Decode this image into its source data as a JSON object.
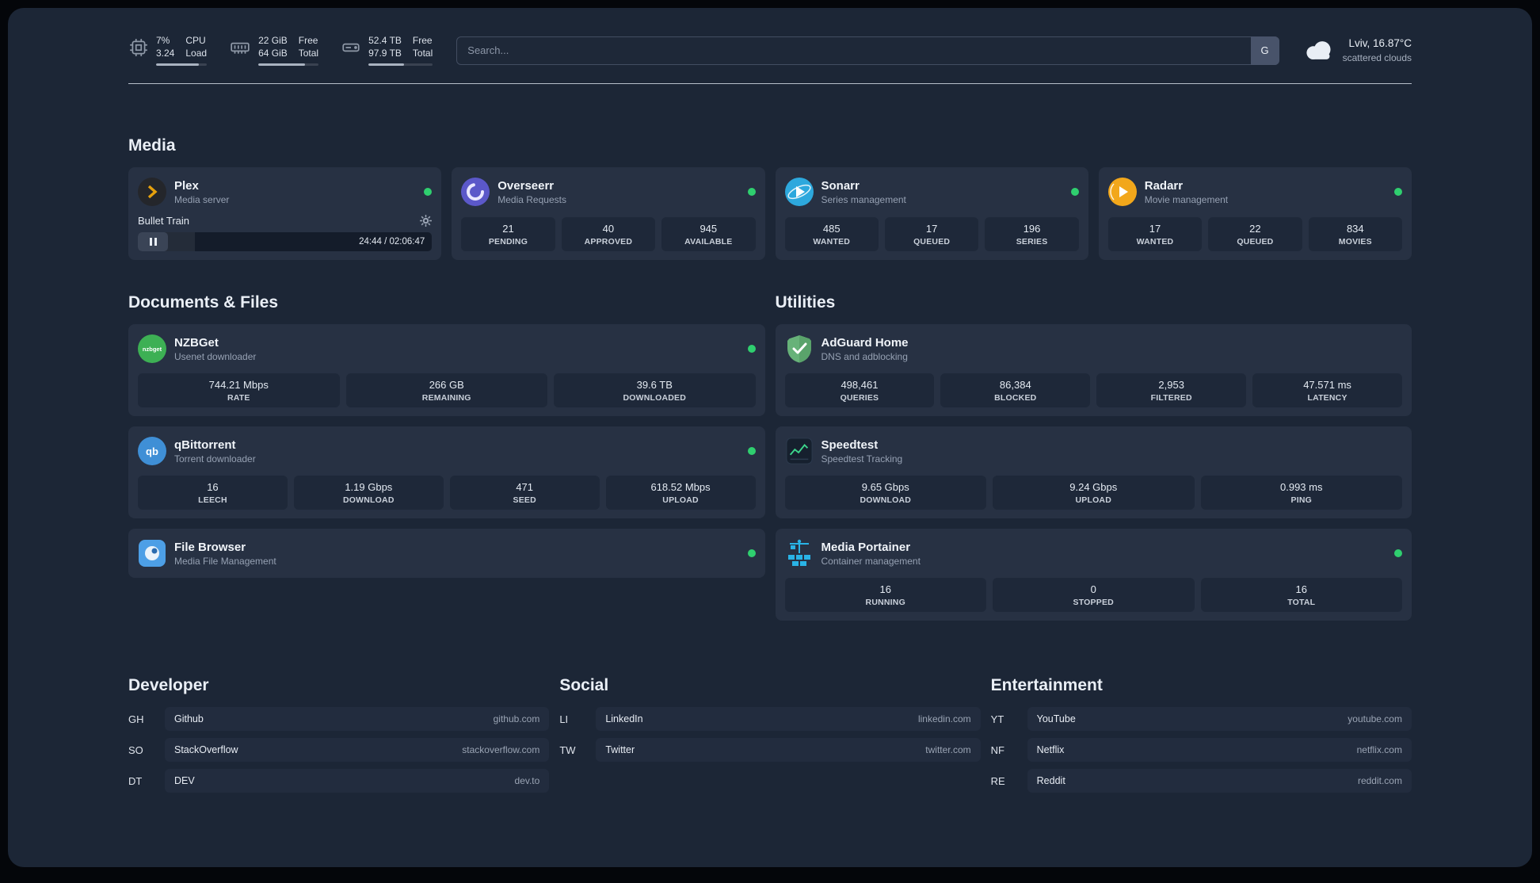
{
  "colors": {
    "page_background": "#1c2636",
    "card_background": "#273143",
    "tile_background": "#1e2839",
    "status_online": "#2fcf6f",
    "plex_accent": "#e5a00d",
    "overseerr_accent": "#5b58c9",
    "sonarr_accent": "#2da8dd",
    "radarr_accent": "#f2a71b",
    "nzbget_accent": "#3db054",
    "qbittorrent_accent": "#3f8fd6",
    "filebrowser_accent": "#4d9fe6",
    "adguard_accent": "#67b279",
    "speedtest_accent": "#3dd68c",
    "portainer_accent": "#29b3e6"
  },
  "icons": {
    "cpu": "chip-outline",
    "memory": "ram-stick-outline",
    "disk": "hard-drive-outline",
    "weather": "cloud-filled",
    "plex": "amber-chevron-in-dark-circle",
    "overseerr": "purple-swirl-circle",
    "sonarr": "blue-circle-play-orbit",
    "radarr": "amber-circle-play-orbit",
    "nzbget": "green-circle-wordmark",
    "qbittorrent": "blue-circle-qb",
    "filebrowser": "blue-rounded-square-disc",
    "adguard": "green-shield-check",
    "speedtest": "dark-square-green-graph",
    "portainer": "blue-crane-containers",
    "gear": "settings-gear",
    "pause": "pause-bars"
  },
  "topbar": {
    "cpu": {
      "value_top": "7%",
      "value_bottom": "3.24",
      "label_top": "CPU",
      "label_bottom": "Load",
      "meter_percent": 85
    },
    "memory": {
      "value_top": "22 GiB",
      "value_bottom": "64 GiB",
      "label_top": "Free",
      "label_bottom": "Total",
      "meter_percent": 78
    },
    "disk": {
      "value_top": "52.4 TB",
      "value_bottom": "97.9 TB",
      "label_top": "Free",
      "label_bottom": "Total",
      "meter_percent": 55
    },
    "search": {
      "placeholder": "Search...",
      "provider_label": "G"
    },
    "weather": {
      "location": "Lviv, 16.87°C",
      "condition": "scattered clouds"
    }
  },
  "media": {
    "heading": "Media",
    "plex": {
      "name": "Plex",
      "desc": "Media server",
      "status": "online",
      "player": {
        "title": "Bullet Train",
        "time": "24:44 / 02:06:47",
        "progress_percent": 19.5
      }
    },
    "overseerr": {
      "name": "Overseerr",
      "desc": "Media Requests",
      "status": "online",
      "stats": [
        {
          "value": "21",
          "label": "PENDING"
        },
        {
          "value": "40",
          "label": "APPROVED"
        },
        {
          "value": "945",
          "label": "AVAILABLE"
        }
      ]
    },
    "sonarr": {
      "name": "Sonarr",
      "desc": "Series management",
      "status": "online",
      "stats": [
        {
          "value": "485",
          "label": "WANTED"
        },
        {
          "value": "17",
          "label": "QUEUED"
        },
        {
          "value": "196",
          "label": "SERIES"
        }
      ]
    },
    "radarr": {
      "name": "Radarr",
      "desc": "Movie management",
      "status": "online",
      "stats": [
        {
          "value": "17",
          "label": "WANTED"
        },
        {
          "value": "22",
          "label": "QUEUED"
        },
        {
          "value": "834",
          "label": "MOVIES"
        }
      ]
    }
  },
  "documents": {
    "heading": "Documents & Files",
    "nzbget": {
      "name": "NZBGet",
      "desc": "Usenet downloader",
      "status": "online",
      "icon_text": "nzbget",
      "stats": [
        {
          "value": "744.21 Mbps",
          "label": "RATE"
        },
        {
          "value": "266 GB",
          "label": "REMAINING"
        },
        {
          "value": "39.6 TB",
          "label": "DOWNLOADED"
        }
      ]
    },
    "qbittorrent": {
      "name": "qBittorrent",
      "desc": "Torrent downloader",
      "status": "online",
      "icon_text": "qb",
      "stats": [
        {
          "value": "16",
          "label": "LEECH"
        },
        {
          "value": "1.19 Gbps",
          "label": "DOWNLOAD"
        },
        {
          "value": "471",
          "label": "SEED"
        },
        {
          "value": "618.52 Mbps",
          "label": "UPLOAD"
        }
      ]
    },
    "filebrowser": {
      "name": "File Browser",
      "desc": "Media File Management",
      "status": "online"
    }
  },
  "utilities": {
    "heading": "Utilities",
    "adguard": {
      "name": "AdGuard Home",
      "desc": "DNS and adblocking",
      "stats": [
        {
          "value": "498,461",
          "label": "QUERIES"
        },
        {
          "value": "86,384",
          "label": "BLOCKED"
        },
        {
          "value": "2,953",
          "label": "FILTERED"
        },
        {
          "value": "47.571 ms",
          "label": "LATENCY"
        }
      ]
    },
    "speedtest": {
      "name": "Speedtest",
      "desc": "Speedtest Tracking",
      "stats": [
        {
          "value": "9.65 Gbps",
          "label": "DOWNLOAD"
        },
        {
          "value": "9.24 Gbps",
          "label": "UPLOAD"
        },
        {
          "value": "0.993 ms",
          "label": "PING"
        }
      ]
    },
    "portainer": {
      "name": "Media Portainer",
      "desc": "Container management",
      "status": "online",
      "stats": [
        {
          "value": "16",
          "label": "RUNNING"
        },
        {
          "value": "0",
          "label": "STOPPED"
        },
        {
          "value": "16",
          "label": "TOTAL"
        }
      ]
    }
  },
  "bookmarks": {
    "developer": {
      "heading": "Developer",
      "links": [
        {
          "abbr": "GH",
          "name": "Github",
          "domain": "github.com"
        },
        {
          "abbr": "SO",
          "name": "StackOverflow",
          "domain": "stackoverflow.com"
        },
        {
          "abbr": "DT",
          "name": "DEV",
          "domain": "dev.to"
        }
      ]
    },
    "social": {
      "heading": "Social",
      "links": [
        {
          "abbr": "LI",
          "name": "LinkedIn",
          "domain": "linkedin.com"
        },
        {
          "abbr": "TW",
          "name": "Twitter",
          "domain": "twitter.com"
        }
      ]
    },
    "entertainment": {
      "heading": "Entertainment",
      "links": [
        {
          "abbr": "YT",
          "name": "YouTube",
          "domain": "youtube.com"
        },
        {
          "abbr": "NF",
          "name": "Netflix",
          "domain": "netflix.com"
        },
        {
          "abbr": "RE",
          "name": "Reddit",
          "domain": "reddit.com"
        }
      ]
    }
  }
}
